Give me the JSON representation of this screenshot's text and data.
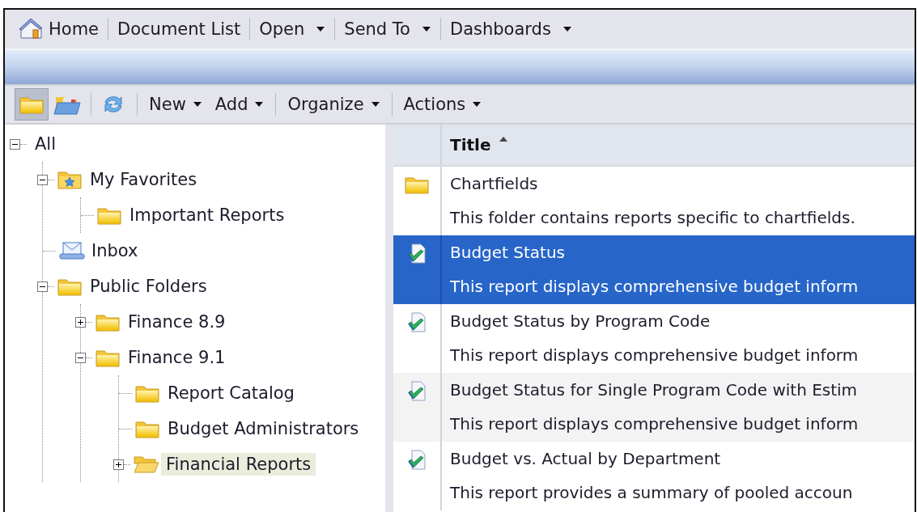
{
  "menubar": {
    "items": [
      {
        "label": "Home",
        "kind": "home"
      },
      {
        "label": "Document List",
        "kind": "link"
      },
      {
        "label": "Open",
        "kind": "dropdown"
      },
      {
        "label": "Send To",
        "kind": "dropdown"
      },
      {
        "label": "Dashboards",
        "kind": "dropdown"
      }
    ]
  },
  "toolbar": {
    "groups": [
      {
        "items": [
          {
            "kind": "folder",
            "selected": true
          },
          {
            "kind": "folders",
            "selected": false
          }
        ]
      },
      {
        "items": [
          {
            "kind": "refresh",
            "selected": false
          }
        ]
      },
      {
        "items": [
          {
            "kind": "dropdown",
            "label": "New"
          },
          {
            "kind": "dropdown",
            "label": "Add"
          }
        ]
      },
      {
        "items": [
          {
            "kind": "dropdown",
            "label": "Organize"
          }
        ]
      },
      {
        "items": [
          {
            "kind": "dropdown",
            "label": "Actions"
          }
        ]
      }
    ]
  },
  "tree": {
    "nodes": [
      {
        "label": "All",
        "expanded": true,
        "selected": false,
        "children": [
          {
            "label": "My Favorites",
            "kind": "favorites",
            "expanded": true,
            "selected": false,
            "children": [
              {
                "label": "Important Reports",
                "kind": "folder",
                "selected": false
              }
            ]
          },
          {
            "label": "Inbox",
            "kind": "inbox",
            "selected": false
          },
          {
            "label": "Public Folders",
            "kind": "folder",
            "expanded": true,
            "selected": false,
            "children": [
              {
                "label": "Finance 8.9",
                "kind": "folder",
                "expanded": false,
                "selected": false
              },
              {
                "label": "Finance 9.1",
                "kind": "folder",
                "expanded": true,
                "selected": false,
                "children": [
                  {
                    "label": "Report Catalog",
                    "kind": "folder",
                    "selected": false
                  },
                  {
                    "label": "Budget Administrators",
                    "kind": "folder",
                    "selected": false
                  },
                  {
                    "label": "Financial Reports",
                    "kind": "open-folder",
                    "expanded": false,
                    "selected": true
                  }
                ]
              }
            ]
          }
        ]
      }
    ]
  },
  "table": {
    "columns": [
      {
        "label": "Title",
        "sort_ascending": true
      }
    ],
    "rows": [
      {
        "kind": "folder",
        "title": "Chartfields",
        "description": "This folder contains reports specific to chartfields.",
        "selected": false
      },
      {
        "kind": "report",
        "title": "Budget Status",
        "description": "This report displays comprehensive budget inform",
        "selected": true
      },
      {
        "kind": "report",
        "title": "Budget Status by Program Code",
        "description": "This report displays comprehensive budget inform",
        "selected": false
      },
      {
        "kind": "report",
        "title": "Budget Status for Single Program Code with Estim",
        "description": "This report displays comprehensive budget inform",
        "selected": false
      },
      {
        "kind": "report",
        "title": "Budget vs. Actual by Department",
        "description": "This report provides a summary of pooled accoun",
        "selected": false
      }
    ]
  }
}
